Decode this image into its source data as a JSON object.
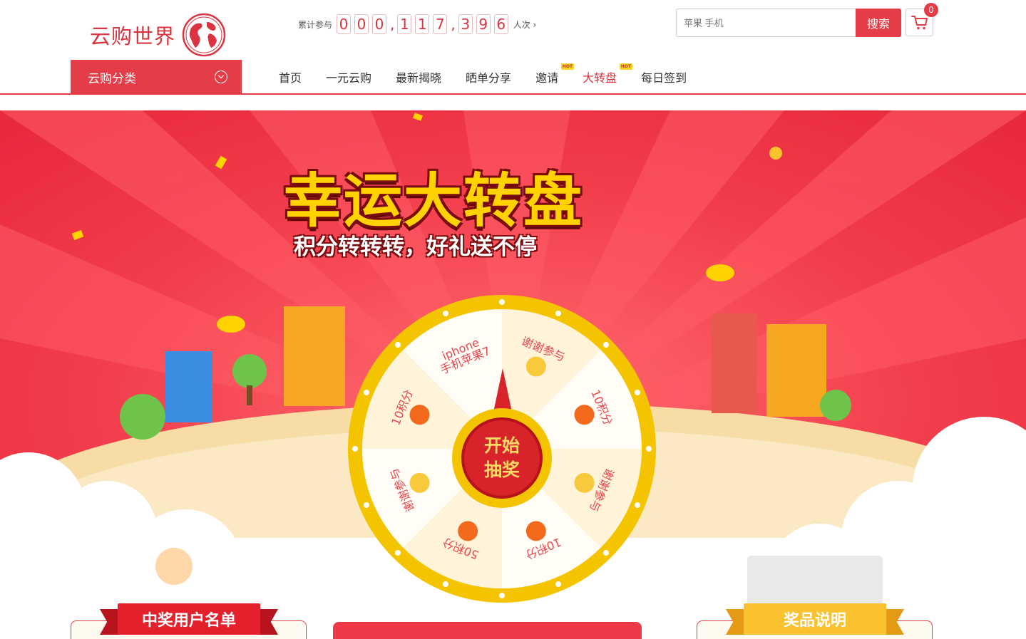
{
  "header": {
    "logo_text": "云购世界",
    "counter": {
      "prefix": "累计参与",
      "digits": [
        "0",
        "0",
        "0",
        "1",
        "1",
        "7",
        "3",
        "9",
        "6"
      ],
      "separator": ",",
      "suffix": "人次 ›"
    },
    "search": {
      "placeholder": "苹果 手机",
      "button_label": "搜索"
    },
    "cart": {
      "count": "0"
    },
    "category": {
      "label": "云购分类"
    },
    "nav": {
      "home": "首页",
      "one_yuan": "一元云购",
      "latest": "最新揭晓",
      "share": "晒单分享",
      "invite": "邀请",
      "wheel": "大转盘",
      "checkin": "每日签到",
      "hot_badge": "HOT"
    }
  },
  "banner": {
    "title": "幸运大转盘",
    "subtitle": "积分转转转，好礼送不停",
    "wheel_segments": [
      {
        "label_1": "iphone",
        "label_2": "手机苹果7"
      },
      {
        "label_1": "谢谢参与",
        "label_2": ""
      },
      {
        "label_1": "10积分",
        "label_2": ""
      },
      {
        "label_1": "谢谢参与",
        "label_2": ""
      },
      {
        "label_1": "10积分",
        "label_2": ""
      },
      {
        "label_1": "50积分",
        "label_2": ""
      },
      {
        "label_1": "谢谢参与",
        "label_2": ""
      },
      {
        "label_1": "10积分",
        "label_2": ""
      }
    ],
    "start_button": {
      "line1": "开始",
      "line2": "抽奖"
    },
    "winners_ribbon": "中奖用户名单",
    "prize_ribbon": "奖品说明"
  },
  "colors": {
    "brand_red": "#e43d47",
    "banner_red": "#f23c4b",
    "wheel_gold": "#f5c400",
    "ribbon_yellow": "#f9c22e"
  }
}
